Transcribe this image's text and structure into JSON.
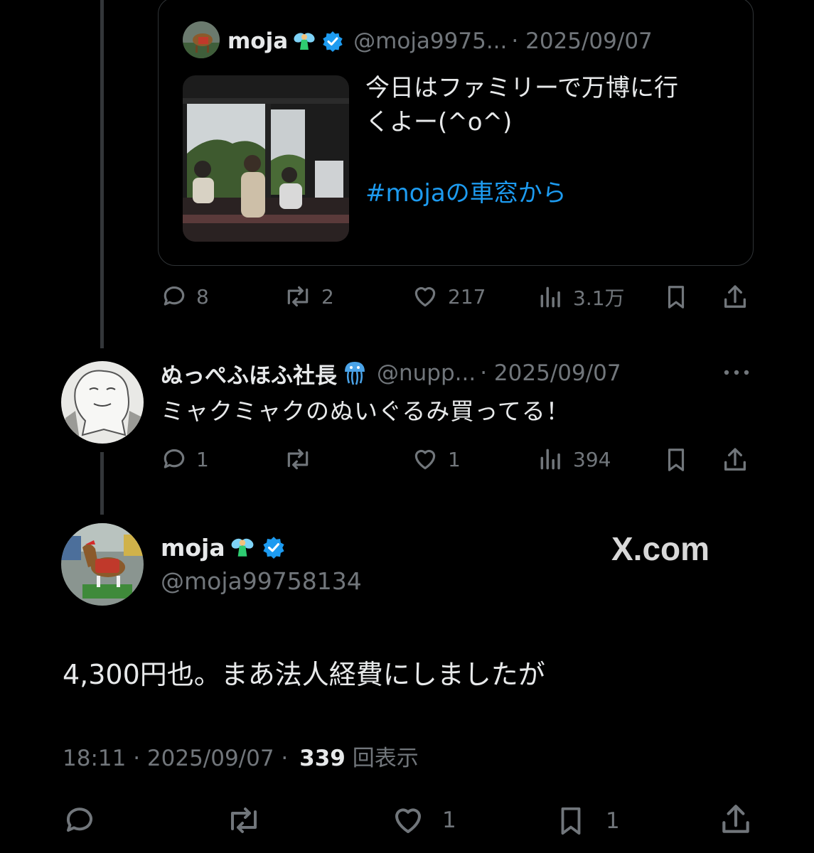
{
  "quoted": {
    "name": "moja",
    "handle": "@moja9975...",
    "date": "· 2025/09/07",
    "text_line1": "今日はファミリーで万博に行",
    "text_line2": "くよー(^o^)",
    "hashtag": "#mojaの車窓から"
  },
  "quoted_actions": {
    "replies": "8",
    "reposts": "2",
    "likes": "217",
    "views": "3.1万"
  },
  "reply": {
    "name": "ぬっぺふほふ社長",
    "handle": "@nupp...",
    "date": "· 2025/09/07",
    "text": "ミャクミャクのぬいぐるみ買ってる！"
  },
  "reply_actions": {
    "replies": "1",
    "reposts": "",
    "likes": "1",
    "views": "394"
  },
  "main": {
    "name": "moja",
    "handle": "@moja99758134",
    "watermark": "X.com",
    "text": "4,300円也。まあ法人経費にしましたが",
    "time": "18:11 · 2025/09/07 ·",
    "views_count": "339",
    "views_label": "回表示"
  },
  "main_actions": {
    "replies": "",
    "reposts": "",
    "likes": "1",
    "bookmarks": "1"
  },
  "colors": {
    "background": "#000000",
    "text": "#e7e9ea",
    "muted": "#71767b",
    "link": "#1d9bf0",
    "verified": "#1d9bf0"
  },
  "icons": [
    "reply-icon",
    "repost-icon",
    "like-icon",
    "views-icon",
    "bookmark-icon",
    "share-icon",
    "verified-icon",
    "fairy-emoji",
    "jellyfish-emoji",
    "more-icon"
  ]
}
